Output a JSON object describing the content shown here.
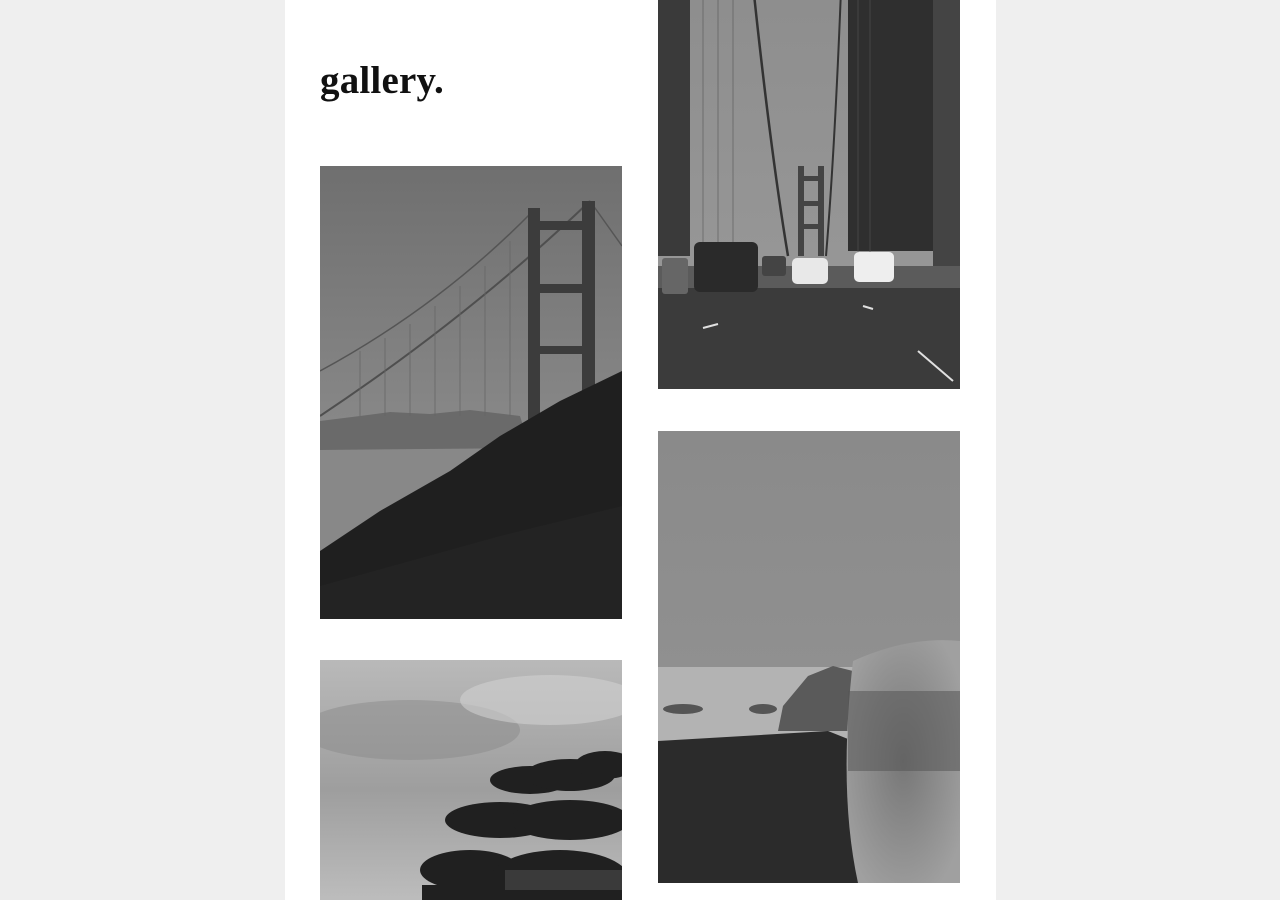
{
  "gallery": {
    "title": "gallery.",
    "photos": [
      {
        "subject": "golden-gate-bridge-from-headlands"
      },
      {
        "subject": "cypress-trees-under-cloudy-sky"
      },
      {
        "subject": "golden-gate-bridge-roadway-traffic"
      },
      {
        "subject": "coastal-cliffs-and-ocean"
      }
    ]
  }
}
